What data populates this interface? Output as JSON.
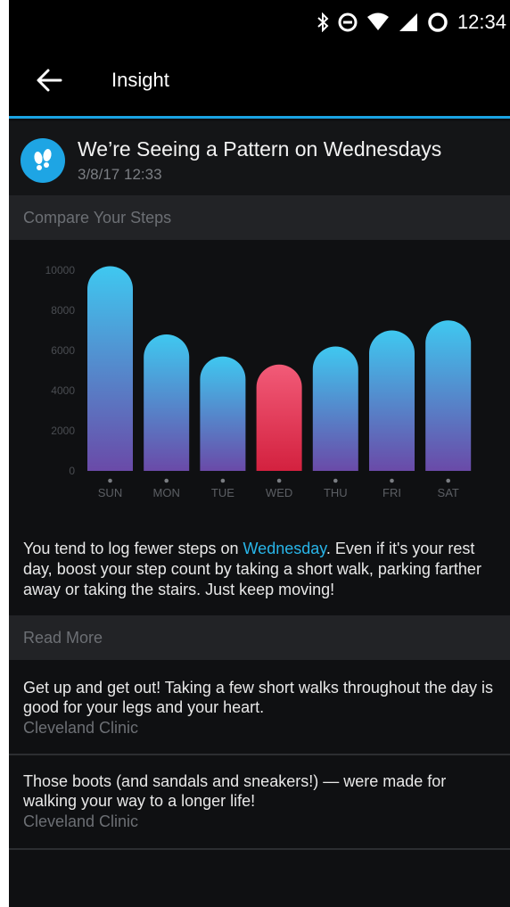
{
  "status_bar": {
    "time": "12:34"
  },
  "app_bar": {
    "title": "Insight"
  },
  "insight": {
    "title": "We’re Seeing a Pattern on Wednesdays",
    "date": "3/8/17 12:33",
    "text_before": "You tend to log fewer steps on ",
    "highlight": "Wednesday",
    "text_after": ". Even if it's your rest day, boost your step count by taking a short walk, parking farther away or taking the stairs. Just keep moving!"
  },
  "sections": {
    "compare": "Compare Your Steps",
    "read_more": "Read More"
  },
  "chart_data": {
    "type": "bar",
    "categories": [
      "SUN",
      "MON",
      "TUE",
      "WED",
      "THU",
      "FRI",
      "SAT"
    ],
    "values": [
      10200,
      6800,
      5700,
      5300,
      6200,
      7000,
      7500
    ],
    "highlight_category": "WED",
    "ylim": [
      0,
      10000
    ],
    "yticks": [
      0,
      2000,
      4000,
      6000,
      8000,
      10000
    ],
    "colors": {
      "bar_top": "#3fc8f0",
      "bar_bottom": "#6a4aa8",
      "highlight_top": "#f25b78",
      "highlight_bottom": "#d3213f"
    }
  },
  "articles": [
    {
      "text": "Get up and get out! Taking a few short walks throughout the day is good for your legs and your heart.",
      "source": "Cleveland Clinic"
    },
    {
      "text": "Those boots (and sandals and sneakers!) — were made for walking your way to a longer life!",
      "source": "Cleveland Clinic"
    }
  ]
}
